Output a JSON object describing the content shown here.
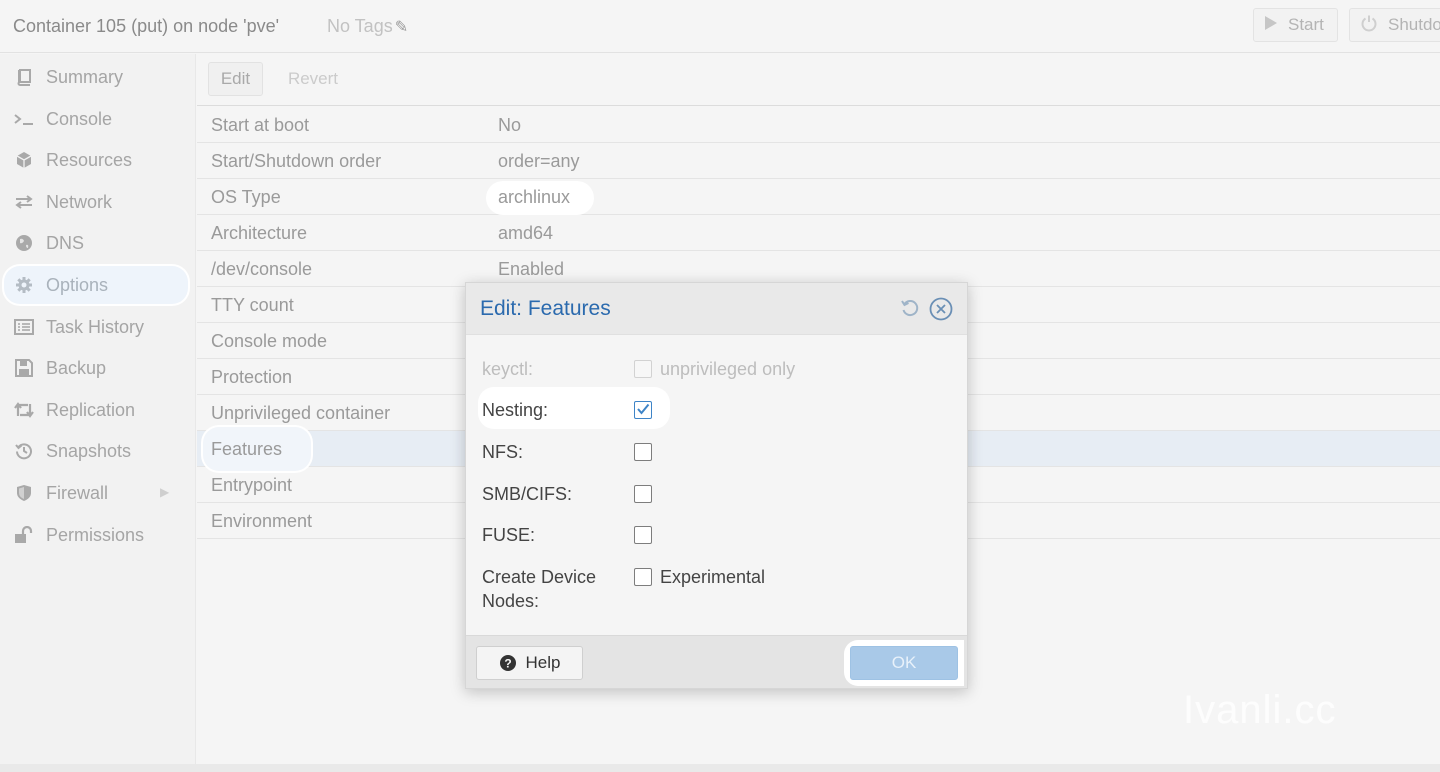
{
  "header": {
    "title": "Container 105 (put) on node 'pve'",
    "tags": "No Tags",
    "buttons": {
      "start": "Start",
      "shutdown": "Shutdo"
    }
  },
  "sidebar": {
    "items": [
      {
        "label": "Summary",
        "icon": "book-icon"
      },
      {
        "label": "Console",
        "icon": "terminal-icon"
      },
      {
        "label": "Resources",
        "icon": "cube-icon"
      },
      {
        "label": "Network",
        "icon": "exchange-icon"
      },
      {
        "label": "DNS",
        "icon": "globe-icon"
      },
      {
        "label": "Options",
        "icon": "gear-icon",
        "active": true
      },
      {
        "label": "Task History",
        "icon": "list-icon"
      },
      {
        "label": "Backup",
        "icon": "floppy-icon"
      },
      {
        "label": "Replication",
        "icon": "retweet-icon"
      },
      {
        "label": "Snapshots",
        "icon": "history-icon"
      },
      {
        "label": "Firewall",
        "icon": "shield-icon"
      },
      {
        "label": "Permissions",
        "icon": "unlock-icon"
      }
    ]
  },
  "toolbar": {
    "edit": "Edit",
    "revert": "Revert"
  },
  "options": {
    "rows": [
      {
        "key": "Start at boot",
        "value": "No"
      },
      {
        "key": "Start/Shutdown order",
        "value": "order=any"
      },
      {
        "key": "OS Type",
        "value": "archlinux"
      },
      {
        "key": "Architecture",
        "value": "amd64"
      },
      {
        "key": "/dev/console",
        "value": "Enabled"
      },
      {
        "key": "TTY count",
        "value": ""
      },
      {
        "key": "Console mode",
        "value": ""
      },
      {
        "key": "Protection",
        "value": ""
      },
      {
        "key": "Unprivileged container",
        "value": ""
      },
      {
        "key": "Features",
        "value": "",
        "selected": true
      },
      {
        "key": "Entrypoint",
        "value": ""
      },
      {
        "key": "Environment",
        "value": ""
      }
    ]
  },
  "dialog": {
    "title": "Edit: Features",
    "fields": [
      {
        "label": "keyctl:",
        "checked": false,
        "disabled": true,
        "box_label": "unprivileged only"
      },
      {
        "label": "Nesting:",
        "checked": true
      },
      {
        "label": "NFS:",
        "checked": false
      },
      {
        "label": "SMB/CIFS:",
        "checked": false
      },
      {
        "label": "FUSE:",
        "checked": false
      },
      {
        "label_line1": "Create Device",
        "label_line2": "Nodes:",
        "checked": false,
        "box_label": "Experimental"
      }
    ],
    "help": "Help",
    "ok": "OK"
  },
  "watermark": "Ivanli.cc",
  "colors": {
    "accent": "#2b6aae",
    "checkbox_check": "#3e84c7",
    "ok_button": "#a9c9e8"
  }
}
